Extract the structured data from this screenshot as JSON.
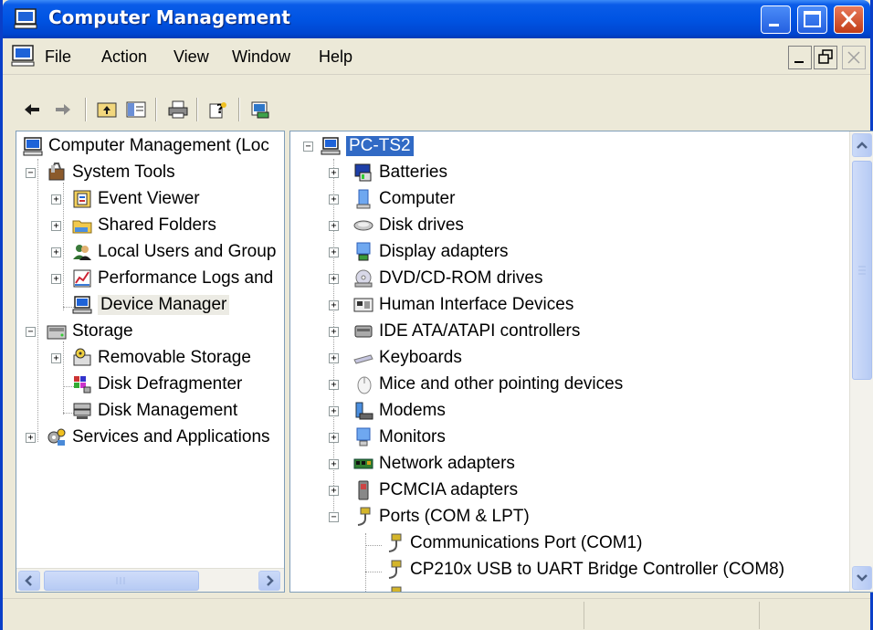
{
  "window": {
    "title": "Computer Management",
    "colors": {
      "titlebar": "#0054e3",
      "selection": "#316ac5",
      "face": "#ece9d8"
    }
  },
  "menu": {
    "items": [
      "File",
      "Action",
      "View",
      "Window",
      "Help"
    ]
  },
  "toolbar": {
    "icons": [
      "back-arrow-icon",
      "forward-arrow-icon",
      "up-folder-icon",
      "show-hide-tree-icon",
      "print-icon",
      "help-icon",
      "properties-icon"
    ]
  },
  "left_tree": {
    "root": "Computer Management (Loc",
    "items": [
      {
        "label": "System Tools",
        "icon": "toolbox-icon"
      },
      {
        "label": "Event Viewer",
        "icon": "event-viewer-icon"
      },
      {
        "label": "Shared Folders",
        "icon": "shared-folder-icon"
      },
      {
        "label": "Local Users and Group",
        "icon": "users-icon"
      },
      {
        "label": "Performance Logs and",
        "icon": "performance-icon"
      },
      {
        "label": "Device Manager",
        "icon": "computer-icon"
      },
      {
        "label": "Storage",
        "icon": "storage-icon"
      },
      {
        "label": "Removable Storage",
        "icon": "removable-storage-icon"
      },
      {
        "label": "Disk Defragmenter",
        "icon": "defrag-icon"
      },
      {
        "label": "Disk Management",
        "icon": "disk-management-icon"
      },
      {
        "label": "Services and Applications",
        "icon": "services-icon"
      }
    ]
  },
  "right_tree": {
    "root": "PC-TS2",
    "categories": [
      {
        "label": "Batteries",
        "icon": "battery-icon"
      },
      {
        "label": "Computer",
        "icon": "computer-icon"
      },
      {
        "label": "Disk drives",
        "icon": "disk-drive-icon"
      },
      {
        "label": "Display adapters",
        "icon": "display-adapter-icon"
      },
      {
        "label": "DVD/CD-ROM drives",
        "icon": "cdrom-icon"
      },
      {
        "label": "Human Interface Devices",
        "icon": "hid-icon"
      },
      {
        "label": "IDE ATA/ATAPI controllers",
        "icon": "ide-controller-icon"
      },
      {
        "label": "Keyboards",
        "icon": "keyboard-icon"
      },
      {
        "label": "Mice and other pointing devices",
        "icon": "mouse-icon"
      },
      {
        "label": "Modems",
        "icon": "modem-icon"
      },
      {
        "label": "Monitors",
        "icon": "monitor-icon"
      },
      {
        "label": "Network adapters",
        "icon": "network-adapter-icon"
      },
      {
        "label": "PCMCIA adapters",
        "icon": "pcmcia-icon"
      },
      {
        "label": "Ports (COM & LPT)",
        "icon": "port-icon"
      }
    ],
    "ports": [
      "Communications Port (COM1)",
      "CP210x USB to UART Bridge Controller (COM8)"
    ]
  }
}
